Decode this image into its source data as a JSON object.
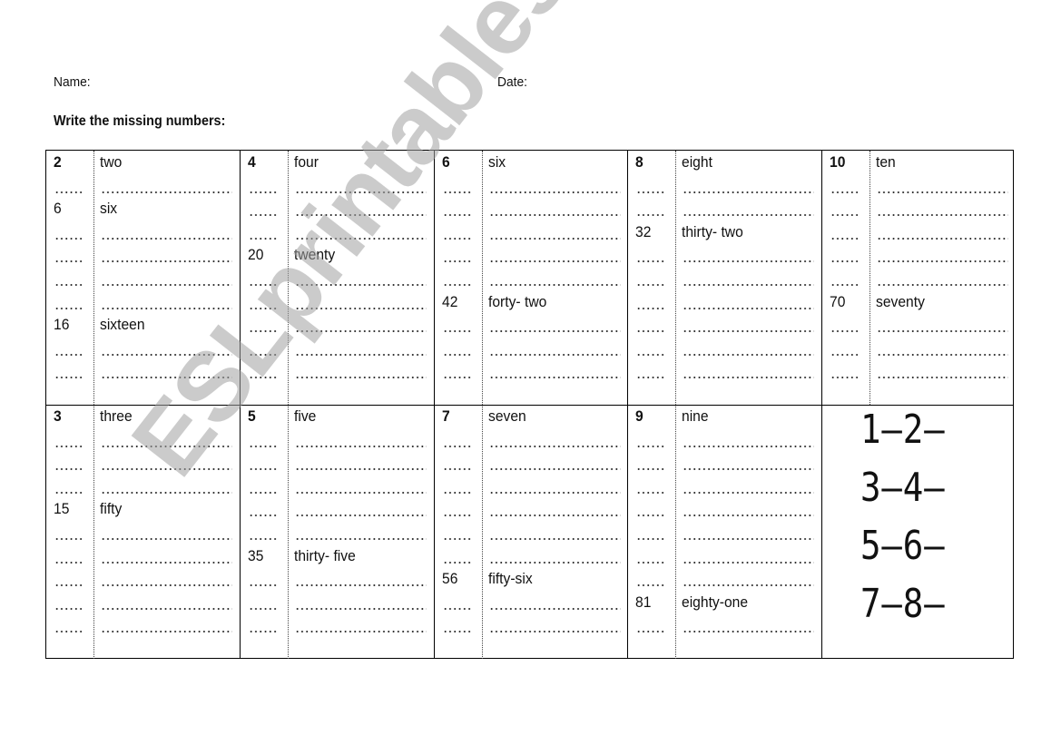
{
  "header": {
    "name_label": "Name:",
    "date_label": "Date:"
  },
  "instructions": "Write the missing numbers:",
  "sections": [
    {
      "columns": [
        {
          "rows": [
            {
              "num": "2",
              "word": "two",
              "start": true
            },
            {
              "blank": true
            },
            {
              "num": "6",
              "word": "six"
            },
            {
              "blank": true
            },
            {
              "blank": true
            },
            {
              "blank": true
            },
            {
              "blank": true
            },
            {
              "num": "16",
              "word": "sixteen"
            },
            {
              "blank": true
            },
            {
              "blank": true
            }
          ]
        },
        {
          "rows": [
            {
              "num": "4",
              "word": "four",
              "start": true
            },
            {
              "blank": true
            },
            {
              "blank": true
            },
            {
              "blank": true
            },
            {
              "num": "20",
              "word": "twenty"
            },
            {
              "blank": true
            },
            {
              "blank": true
            },
            {
              "blank": true
            },
            {
              "blank": true
            },
            {
              "blank": true
            }
          ]
        },
        {
          "rows": [
            {
              "num": "6",
              "word": "six",
              "start": true
            },
            {
              "blank": true
            },
            {
              "blank": true
            },
            {
              "blank": true
            },
            {
              "blank": true
            },
            {
              "blank": true
            },
            {
              "num": "42",
              "word": "forty- two"
            },
            {
              "blank": true
            },
            {
              "blank": true
            },
            {
              "blank": true
            }
          ]
        },
        {
          "rows": [
            {
              "num": "8",
              "word": "eight",
              "start": true
            },
            {
              "blank": true
            },
            {
              "blank": true
            },
            {
              "num": "32",
              "word": "thirty- two"
            },
            {
              "blank": true
            },
            {
              "blank": true
            },
            {
              "blank": true
            },
            {
              "blank": true
            },
            {
              "blank": true
            },
            {
              "blank": true
            }
          ]
        },
        {
          "rows": [
            {
              "num": "10",
              "word": "ten",
              "start": true
            },
            {
              "blank": true
            },
            {
              "blank": true
            },
            {
              "blank": true
            },
            {
              "blank": true
            },
            {
              "blank": true
            },
            {
              "num": "70",
              "word": "seventy"
            },
            {
              "blank": true
            },
            {
              "blank": true
            },
            {
              "blank": true
            }
          ]
        }
      ]
    },
    {
      "columns": [
        {
          "rows": [
            {
              "num": "3",
              "word": "three",
              "start": true
            },
            {
              "blank": true
            },
            {
              "blank": true
            },
            {
              "blank": true
            },
            {
              "num": "15",
              "word": "fifty"
            },
            {
              "blank": true
            },
            {
              "blank": true
            },
            {
              "blank": true
            },
            {
              "blank": true
            },
            {
              "blank": true
            }
          ]
        },
        {
          "rows": [
            {
              "num": "5",
              "word": "five",
              "start": true
            },
            {
              "blank": true
            },
            {
              "blank": true
            },
            {
              "blank": true
            },
            {
              "blank": true
            },
            {
              "blank": true
            },
            {
              "num": "35",
              "word": "thirty- five"
            },
            {
              "blank": true
            },
            {
              "blank": true
            },
            {
              "blank": true
            }
          ]
        },
        {
          "rows": [
            {
              "num": "7",
              "word": "seven",
              "start": true
            },
            {
              "blank": true
            },
            {
              "blank": true
            },
            {
              "blank": true
            },
            {
              "blank": true
            },
            {
              "blank": true
            },
            {
              "blank": true
            },
            {
              "num": "56",
              "word": "fifty-six"
            },
            {
              "blank": true
            },
            {
              "blank": true
            }
          ]
        },
        {
          "rows": [
            {
              "num": "9",
              "word": "nine",
              "start": true
            },
            {
              "blank": true
            },
            {
              "blank": true
            },
            {
              "blank": true
            },
            {
              "blank": true
            },
            {
              "blank": true
            },
            {
              "blank": true
            },
            {
              "blank": true
            },
            {
              "num": "81",
              "word": "eighty-one"
            },
            {
              "blank": true
            }
          ]
        }
      ],
      "sequence_box": [
        "1–2–",
        "3–4–",
        "5–6–",
        "7–8–"
      ]
    }
  ],
  "watermark": "ESLprintables.com"
}
